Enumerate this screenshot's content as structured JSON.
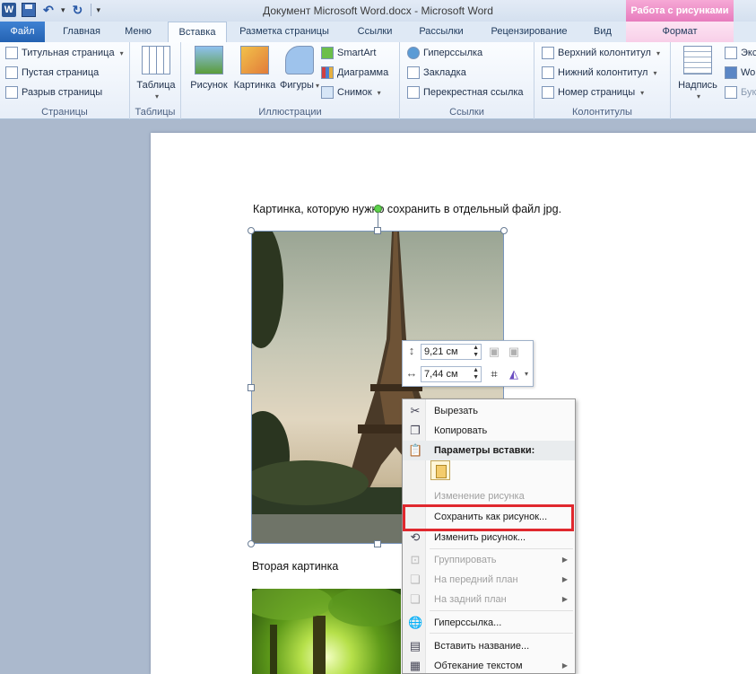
{
  "window": {
    "title": "Документ Microsoft Word.docx - Microsoft Word",
    "context_band": "Работа с рисунками"
  },
  "qat": {
    "app_icon": "W",
    "undo_glyph": "↶",
    "redo_glyph": "↻"
  },
  "tabs": [
    {
      "label": "Файл"
    },
    {
      "label": "Главная"
    },
    {
      "label": "Меню"
    },
    {
      "label": "Вставка"
    },
    {
      "label": "Разметка страницы"
    },
    {
      "label": "Ссылки"
    },
    {
      "label": "Рассылки"
    },
    {
      "label": "Рецензирование"
    },
    {
      "label": "Вид"
    },
    {
      "label": "Формат"
    }
  ],
  "ribbon": {
    "pages": {
      "label": "Страницы",
      "items": [
        "Титульная страница",
        "Пустая страница",
        "Разрыв страницы"
      ]
    },
    "tables": {
      "label": "Таблицы",
      "table": "Таблица"
    },
    "illustrations": {
      "label": "Иллюстрации",
      "picture": "Рисунок",
      "clipart": "Картинка",
      "shapes": "Фигуры",
      "smartart": "SmartArt",
      "chart": "Диаграмма",
      "screenshot": "Снимок"
    },
    "links": {
      "label": "Ссылки",
      "items": [
        "Гиперссылка",
        "Закладка",
        "Перекрестная ссылка"
      ]
    },
    "headers": {
      "label": "Колонтитулы",
      "items": [
        "Верхний колонтитул",
        "Нижний колонтитул",
        "Номер страницы"
      ]
    },
    "text": {
      "textbox": "Надпись",
      "items": [
        "Экс",
        "Wo",
        "Бук"
      ]
    }
  },
  "document": {
    "line1": "Картинка, которую нужно сохранить в отдельный файл jpg.",
    "line2": "Вторая картинка"
  },
  "minibar": {
    "height": "9,21 см",
    "width": "7,44 см"
  },
  "context_menu": {
    "cut": "Вырезать",
    "copy": "Копировать",
    "paste_options": "Параметры вставки:",
    "change_picture_disabled": "Изменение рисунка",
    "save_as_picture": "Сохранить как рисунок...",
    "change_picture": "Изменить рисунок...",
    "group": "Группировать",
    "bring_front": "На передний план",
    "send_back": "На задний план",
    "hyperlink": "Гиперссылка...",
    "insert_caption": "Вставить название...",
    "text_wrap": "Обтекание текстом"
  },
  "colors": {
    "highlight": "#e0282e",
    "file_tab": "#2a6bc2",
    "context_tab": "#e77cbd"
  }
}
